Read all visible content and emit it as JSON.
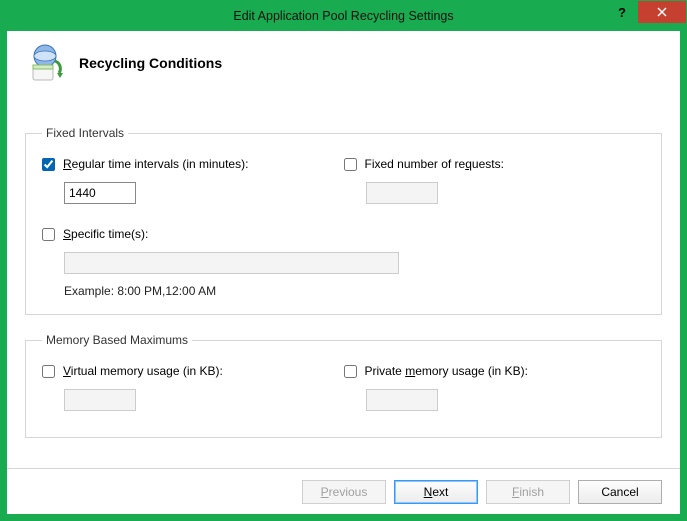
{
  "window": {
    "title": "Edit Application Pool Recycling Settings"
  },
  "header": {
    "title": "Recycling Conditions"
  },
  "groups": {
    "fixed": {
      "legend": "Fixed Intervals",
      "regular": {
        "label": "Regular time intervals (in minutes):",
        "label_u": "R",
        "label_rest": "egular time intervals (in minutes):",
        "checked": true,
        "value": "1440"
      },
      "requests": {
        "label_pre": "Fixed number of re",
        "label_u": "q",
        "label_post": "uests:",
        "checked": false,
        "value": ""
      },
      "specific": {
        "label_u": "S",
        "label_rest": "pecific time(s):",
        "checked": false,
        "value": "",
        "example": "Example: 8:00 PM,12:00 AM"
      }
    },
    "memory": {
      "legend": "Memory Based Maximums",
      "virtual": {
        "label_u": "V",
        "label_rest": "irtual memory usage (in KB):",
        "checked": false,
        "value": ""
      },
      "private": {
        "label_pre": "Private ",
        "label_u": "m",
        "label_post": "emory usage (in KB):",
        "checked": false,
        "value": ""
      }
    }
  },
  "buttons": {
    "previous": {
      "u": "P",
      "rest": "revious",
      "enabled": false
    },
    "next": {
      "u": "N",
      "rest": "ext",
      "enabled": true
    },
    "finish": {
      "u": "F",
      "rest": "inish",
      "enabled": false
    },
    "cancel": {
      "label": "Cancel",
      "enabled": true
    }
  }
}
